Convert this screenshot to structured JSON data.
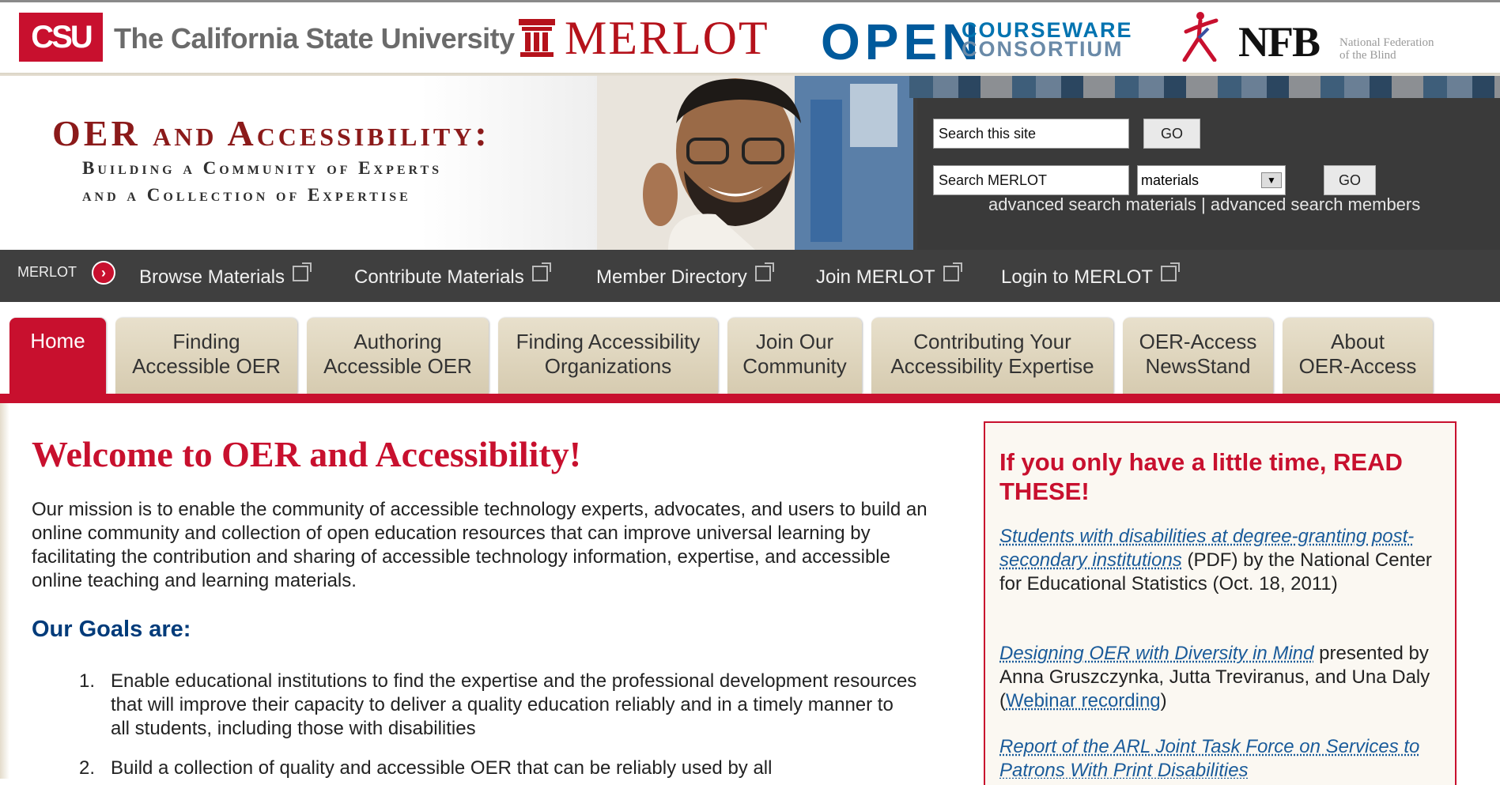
{
  "partners": {
    "csu_box": "CSU",
    "csu_name": "The California State University",
    "merlot": "MERLOT",
    "ocw_big": "OPEN",
    "ocw_line1": "COURSEWARE",
    "ocw_line2": "CONSORTIUM",
    "nfb": "NFB",
    "nfb_line1": "National Federation",
    "nfb_line2": "of the Blind"
  },
  "banner": {
    "title": "OER and Accessibility:",
    "subtitle1": "Building a Community of Experts",
    "subtitle2": "and a Collection of Expertise"
  },
  "search": {
    "site_value": "Search this site",
    "site_go": "GO",
    "merlot_value": "Search MERLOT",
    "select_value": "materials",
    "merlot_go": "GO",
    "adv_materials": "advanced search materials",
    "separator": "|",
    "adv_members": "advanced search members"
  },
  "merlot_nav": {
    "label": "MERLOT",
    "arrow": "›",
    "links": [
      "Browse Materials",
      "Contribute Materials",
      "Member Directory",
      "Join MERLOT",
      "Login to MERLOT"
    ]
  },
  "tabs": [
    {
      "line1": "Home",
      "line2": ""
    },
    {
      "line1": "Finding",
      "line2": "Accessible OER"
    },
    {
      "line1": "Authoring",
      "line2": "Accessible OER"
    },
    {
      "line1": "Finding Accessibility",
      "line2": "Organizations"
    },
    {
      "line1": "Join Our",
      "line2": "Community"
    },
    {
      "line1": "Contributing Your",
      "line2": "Accessibility Expertise"
    },
    {
      "line1": "OER-Access",
      "line2": "NewsStand"
    },
    {
      "line1": "About",
      "line2": "OER-Access"
    }
  ],
  "main": {
    "heading": "Welcome to OER and Accessibility!",
    "mission": "Our mission is to enable the community of accessible technology experts, advocates, and users to build an online community and collection of open education resources that can improve universal learning by facilitating the contribution and sharing of accessible technology information, expertise, and accessible online teaching and learning materials.",
    "goals_heading": "Our Goals are:",
    "goals": [
      {
        "num": "1.",
        "text": "Enable educational institutions to find the expertise and the professional development resources that will improve their capacity to deliver a quality education reliably and in a timely manner to all students, including those with disabilities"
      },
      {
        "num": "2.",
        "text": "Build a collection of quality and accessible OER that can be reliably used by all"
      }
    ]
  },
  "sidebar": {
    "heading": "If you only have a little time, READ THESE!",
    "item1_link": "Students with disabilities at degree-granting post-secondary institutions",
    "item1_rest": " (PDF) by the National Center for Educational Statistics (Oct. 18, 2011)",
    "item2_link": "Designing OER with Diversity in Mind",
    "item2_rest": " presented by Anna Gruszczynka, Jutta Treviranus, and Una Daly (",
    "item2_link2": "Webinar recording",
    "item2_close": ")",
    "item3_link": "Report of the ARL Joint Task Force on Services to Patrons With Print Disabilities"
  },
  "colors": {
    "csu_red": "#c8102e",
    "merlot_red": "#b5121b",
    "ocw_blue": "#005a9c",
    "nav_dark": "#3f3f3f",
    "tab_tan": "#ddd3bb",
    "goals_blue": "#003b7a"
  }
}
